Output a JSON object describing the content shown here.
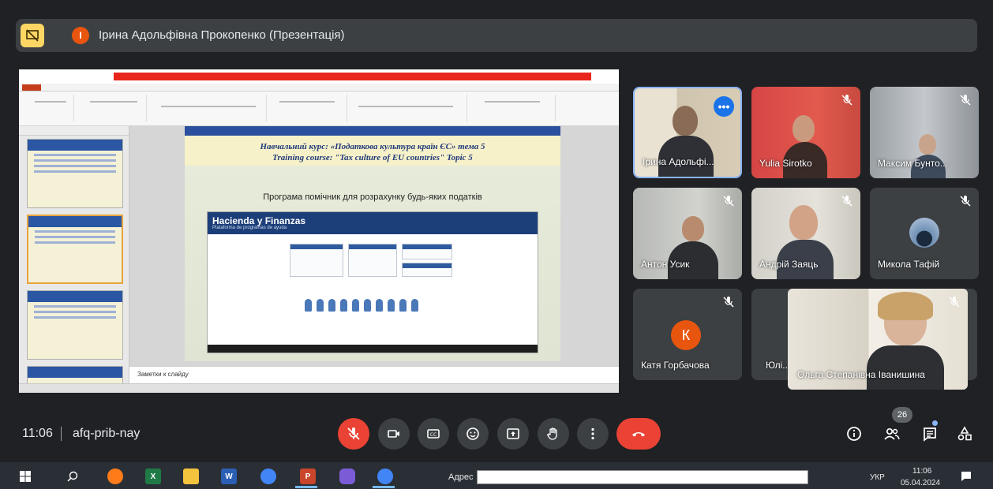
{
  "header": {
    "presenter_initial": "І",
    "presenter_text": "Ірина Адольфівна Прокопенко (Презентація)"
  },
  "slide": {
    "course_uk": "Навчальний курс: «Податкова культура країн ЄС» тема 5",
    "course_en": "Training course: \"Tax culture of EU countries\" Topic 5",
    "subtitle": "Програма помічник для розрахунку будь-яких податків",
    "web_title": "Hacienda y Finanzas",
    "web_subtitle": "Plataforma de programas de ayuda",
    "notes_placeholder": "Заметки к слайду"
  },
  "participants": [
    {
      "name": "Ірина Адольфі...",
      "muted": false,
      "active": true
    },
    {
      "name": "Yulia Sirotko",
      "muted": true
    },
    {
      "name": "Максим Бунто...",
      "muted": true
    },
    {
      "name": "Антон Усик",
      "muted": true
    },
    {
      "name": "Андрій Заяць",
      "muted": true
    },
    {
      "name": "Микола Тафій",
      "muted": true
    },
    {
      "name": "Катя Горбачова",
      "muted": true,
      "initial": "К"
    },
    {
      "name": "Юлі...",
      "muted": true
    },
    {
      "name": "Ольга Степанівна Іванишина",
      "muted": true
    }
  ],
  "controls": {
    "time": "11:06",
    "meeting_code": "afq-prib-nay",
    "participants_count": "26"
  },
  "taskbar": {
    "address_label": "Адрес",
    "address_value": "",
    "language": "УКР",
    "clock_time": "11:06",
    "clock_date": "05.04.2024"
  },
  "colors": {
    "background": "#202124",
    "tile": "#3c4043",
    "danger": "#ea4335",
    "accent": "#8ab4f8",
    "stop_present": "#fdd663"
  },
  "icons": [
    "stop-presenting-icon",
    "mic-off-icon",
    "camera-icon",
    "captions-icon",
    "emoji-icon",
    "present-icon",
    "raise-hand-icon",
    "more-options-icon",
    "hang-up-icon",
    "info-icon",
    "people-icon",
    "chat-icon",
    "activities-icon"
  ]
}
